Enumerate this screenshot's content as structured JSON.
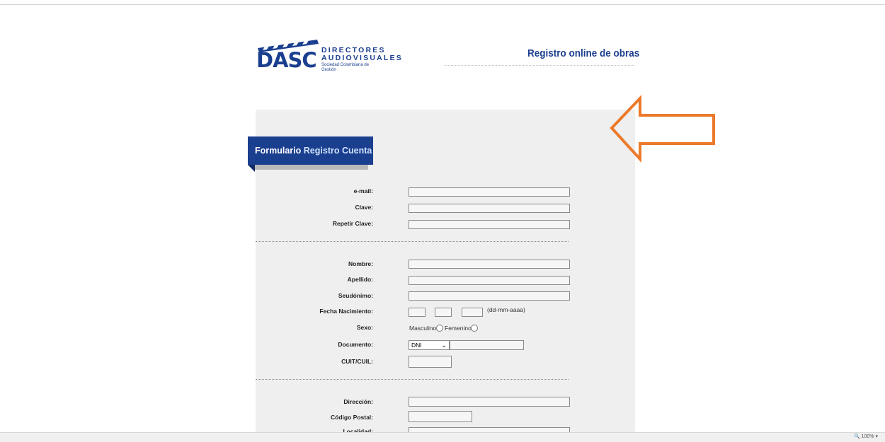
{
  "header": {
    "logo_text": "DASC",
    "logo_line1": "DIRECTORES",
    "logo_line2": "AUDIOVISUALES",
    "logo_line3": "Sociedad Colombiana de Gestión",
    "title": "Registro online de obras"
  },
  "form_tab": {
    "bold": "Formulario",
    "light": "Registro Cuenta"
  },
  "fields": {
    "email": "e-mail:",
    "clave": "Clave:",
    "repetir_clave": "Repetir Clave:",
    "nombre": "Nombre:",
    "apellido": "Apellido:",
    "seudonimo": "Seudónimo:",
    "fecha_nacimiento": "Fecha Nacimiento:",
    "fecha_hint": "(dd-mm-aaaa)",
    "sexo": "Sexo:",
    "sexo_masculino": "Masculino",
    "sexo_femenino": "Femenino",
    "documento": "Documento:",
    "documento_selected": "DNI",
    "cuit": "CUIT/CUIL:",
    "direccion": "Dirección:",
    "codigo_postal": "Código Postal:",
    "localidad": "Localidad:"
  },
  "annotation": {
    "color": "#ec7a2a",
    "icon": "arrow-left-icon"
  },
  "statusbar": {
    "zoom": "100%"
  }
}
